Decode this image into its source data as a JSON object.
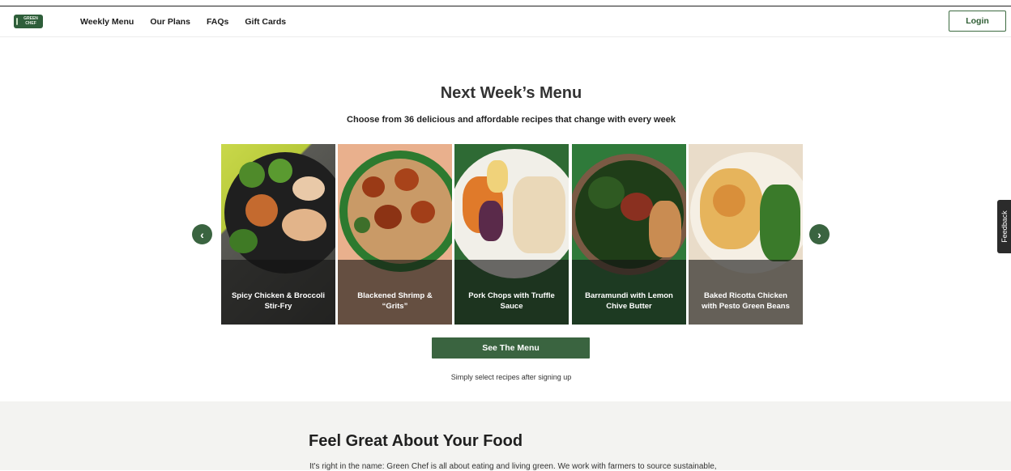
{
  "header": {
    "logo_text": "GREEN CHEF",
    "nav": [
      "Weekly Menu",
      "Our Plans",
      "FAQs",
      "Gift Cards"
    ],
    "login_label": "Login"
  },
  "hero": {
    "title": "Next Week’s Menu",
    "subtitle": "Choose from 36 delicious and affordable recipes that change with every week",
    "prev_icon": "chevron-left-icon",
    "next_icon": "chevron-right-icon",
    "cards": [
      {
        "title_l1": "Spicy Chicken & Broccoli",
        "title_l2": "Stir-Fry"
      },
      {
        "title_l1": "Blackened Shrimp &",
        "title_l2": "“Grits”"
      },
      {
        "title_l1": "Pork Chops with Truffle",
        "title_l2": "Sauce"
      },
      {
        "title_l1": "Barramundi with Lemon",
        "title_l2": "Chive Butter"
      },
      {
        "title_l1": "Baked Ricotta Chicken",
        "title_l2": "with Pesto Green Beans"
      }
    ],
    "cta_label": "See The Menu",
    "note": "Simply select recipes after signing up"
  },
  "section2": {
    "title": "Feel Great About Your Food",
    "body": "It's right in the name: Green Chef is all about eating and living green. We work with farmers to source sustainable,"
  },
  "feedback_label": "Feedback",
  "colors": {
    "brand_green": "#3a6440",
    "lower_bg": "#f3f3f1"
  }
}
